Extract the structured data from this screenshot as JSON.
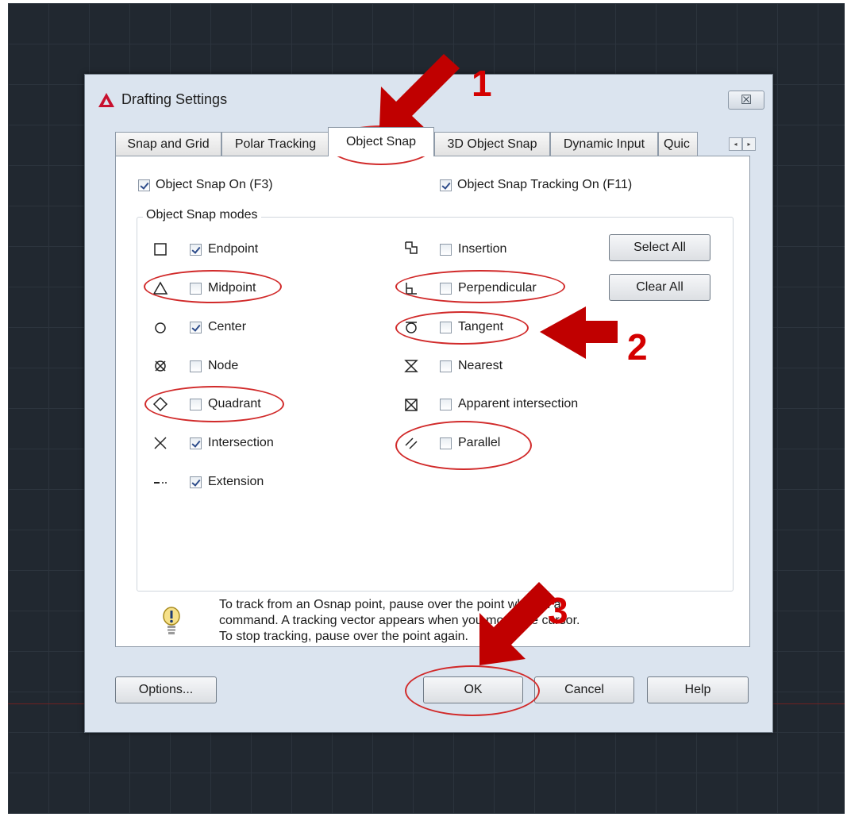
{
  "dialog": {
    "title": "Drafting Settings",
    "close_glyph": "☒"
  },
  "tabs": [
    {
      "label": "Snap and Grid"
    },
    {
      "label": "Polar Tracking"
    },
    {
      "label": "Object Snap"
    },
    {
      "label": "3D Object Snap"
    },
    {
      "label": "Dynamic Input"
    },
    {
      "label": "Quic"
    }
  ],
  "tab_scroll": {
    "left": "◂",
    "right": "▸"
  },
  "object_snap": {
    "snap_on": {
      "label": "Object Snap On (F3)",
      "checked": true
    },
    "tracking_on": {
      "label": "Object Snap Tracking On (F11)",
      "checked": true
    },
    "modes_title": "Object Snap modes",
    "left_modes": [
      {
        "label": "Endpoint",
        "checked": true,
        "icon": "square-icon"
      },
      {
        "label": "Midpoint",
        "checked": false,
        "icon": "triangle-icon"
      },
      {
        "label": "Center",
        "checked": true,
        "icon": "circle-icon"
      },
      {
        "label": "Node",
        "checked": false,
        "icon": "node-icon"
      },
      {
        "label": "Quadrant",
        "checked": false,
        "icon": "diamond-icon"
      },
      {
        "label": "Intersection",
        "checked": true,
        "icon": "x-icon"
      },
      {
        "label": "Extension",
        "checked": true,
        "icon": "extension-icon"
      }
    ],
    "right_modes": [
      {
        "label": "Insertion",
        "checked": false,
        "icon": "insertion-icon"
      },
      {
        "label": "Perpendicular",
        "checked": false,
        "icon": "perpendicular-icon"
      },
      {
        "label": "Tangent",
        "checked": false,
        "icon": "tangent-icon"
      },
      {
        "label": "Nearest",
        "checked": false,
        "icon": "hourglass-icon"
      },
      {
        "label": "Apparent intersection",
        "checked": false,
        "icon": "boxed-x-icon"
      },
      {
        "label": "Parallel",
        "checked": false,
        "icon": "parallel-icon"
      }
    ],
    "select_all": "Select All",
    "clear_all": "Clear All",
    "tip_lines": [
      "To track from an Osnap point, pause over the point while in a",
      "command.  A tracking vector appears when you move the cursor.",
      "To stop tracking, pause over the point again."
    ]
  },
  "footer": {
    "options": "Options...",
    "ok": "OK",
    "cancel": "Cancel",
    "help": "Help"
  },
  "annotations": {
    "step1": "1",
    "step2": "2",
    "step3": "3",
    "color": "#cc0000"
  }
}
